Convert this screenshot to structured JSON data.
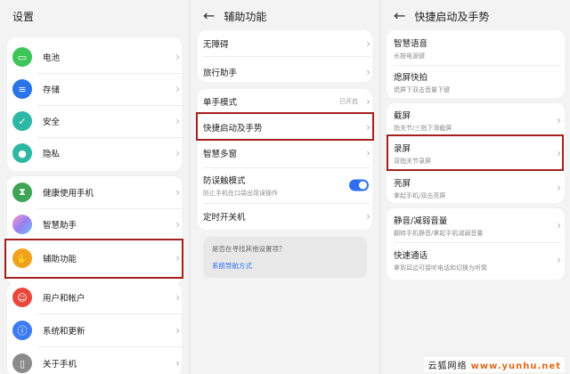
{
  "panel1": {
    "title": "设置",
    "items": [
      {
        "label": "电池",
        "icon": "battery-icon",
        "color": "#3ec55a"
      },
      {
        "label": "存储",
        "icon": "storage-icon",
        "color": "#2a73e8"
      },
      {
        "label": "安全",
        "icon": "shield-icon",
        "color": "#2fb7a5"
      },
      {
        "label": "隐私",
        "icon": "privacy-icon",
        "color": "#2fb7a5"
      },
      {
        "label": "健康使用手机",
        "icon": "hourglass-icon",
        "color": "#3ea457"
      },
      {
        "label": "智慧助手",
        "icon": "assistant-icon",
        "color": "#b07de3"
      },
      {
        "label": "辅助功能",
        "icon": "hand-icon",
        "color": "#f0a21e"
      },
      {
        "label": "用户和帐户",
        "icon": "user-icon",
        "color": "#e8483c"
      },
      {
        "label": "系统和更新",
        "icon": "system-icon",
        "color": "#3d7bf0"
      },
      {
        "label": "关于手机",
        "icon": "phone-info-icon",
        "color": "#8a8a8a"
      }
    ]
  },
  "panel2": {
    "title": "辅助功能",
    "items": [
      {
        "label": "无障碍"
      },
      {
        "label": "旅行助手"
      },
      {
        "label": "单手模式",
        "status": "已开启"
      },
      {
        "label": "快捷启动及手势"
      },
      {
        "label": "智慧多窗"
      },
      {
        "label": "防误触模式",
        "sub": "防止手机在口袋出现误操作",
        "toggle": true
      },
      {
        "label": "定时开关机"
      }
    ],
    "suggest_question": "是否在寻找其他设置项？",
    "suggest_link": "系统导航方式"
  },
  "panel3": {
    "title": "快捷启动及手势",
    "items": [
      {
        "label": "智慧语音",
        "sub": "长按电源键"
      },
      {
        "label": "熄屏快拍",
        "sub": "熄屏下双击音量下键"
      },
      {
        "label": "截屏",
        "sub": "指关节/三指下滑截屏"
      },
      {
        "label": "录屏",
        "sub": "双指关节录屏"
      },
      {
        "label": "亮屏",
        "sub": "拿起手机/双击亮屏"
      },
      {
        "label": "静音/减弱音量",
        "sub": "翻转手机静音/拿起手机减弱音量"
      },
      {
        "label": "快速通话",
        "sub": "拿到耳边可接听电话和切换为听筒"
      }
    ]
  },
  "watermark": {
    "prefix": "云狐网络",
    "url": "www.yunhu.net"
  },
  "colors": {
    "highlight": "#a51f1f",
    "accent": "#2d6ff0"
  }
}
